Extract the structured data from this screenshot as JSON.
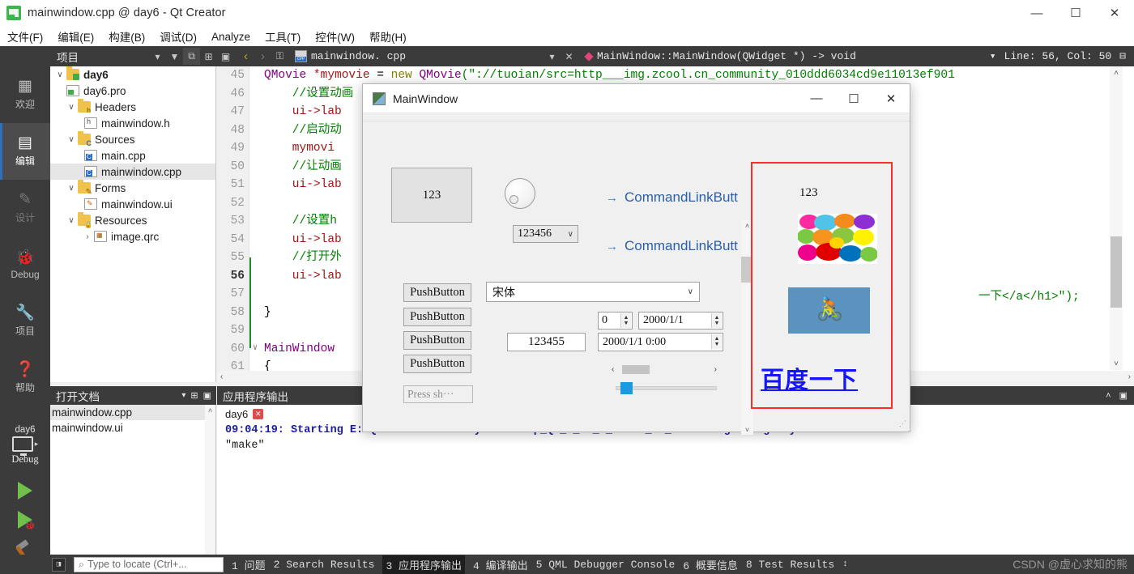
{
  "window": {
    "title": "mainwindow.cpp @ day6 - Qt Creator",
    "minimize": "—",
    "maximize": "☐",
    "close": "✕",
    "app_icon": "qt-creator-icon"
  },
  "menubar": {
    "items": [
      {
        "label": "文件(F)"
      },
      {
        "label": "编辑(E)"
      },
      {
        "label": "构建(B)"
      },
      {
        "label": "调试(D)"
      },
      {
        "label": "Analyze"
      },
      {
        "label": "工具(T)"
      },
      {
        "label": "控件(W)"
      },
      {
        "label": "帮助(H)"
      }
    ]
  },
  "toolrow": {
    "projects_label": "项目",
    "dropdown_caret": "▾",
    "filter_icon": "▼",
    "link_icon": "⧉",
    "split_icon": "⊞",
    "collapse_icon": "▣",
    "back_icon": "‹",
    "forward_icon": "›",
    "lock_icon": "⚿",
    "file_name": "mainwindow. cpp",
    "file_caret": "▾",
    "file_close": "✕",
    "symbol": "MainWindow::MainWindow(QWidget *) -> void",
    "symbol_caret": "▾",
    "line_col": "Line: 56, Col: 50",
    "split_right_icon": "⊟"
  },
  "activitybar": {
    "items": [
      {
        "glyph": "☰",
        "label": "欢迎",
        "state": "normal",
        "name": "welcome"
      },
      {
        "glyph": "▤",
        "label": "编辑",
        "state": "active",
        "name": "edit"
      },
      {
        "glyph": "✎",
        "label": "设计",
        "state": "dim",
        "name": "design"
      },
      {
        "glyph": "☸",
        "label": "Debug",
        "state": "normal",
        "name": "debug"
      },
      {
        "glyph": "⚒",
        "label": "项目",
        "state": "normal",
        "name": "projects"
      },
      {
        "glyph": "?",
        "label": "帮助",
        "state": "normal",
        "name": "help"
      }
    ],
    "kit_name": "day6",
    "kit_mode": "Debug",
    "kit_arrow": "▸"
  },
  "tree": {
    "rows": [
      {
        "twisty": "∨",
        "icon": "folder green",
        "label": "day6",
        "indent": 0,
        "bold": true,
        "selected": false
      },
      {
        "twisty": "",
        "icon": "doc pro",
        "label": "day6.pro",
        "indent": 1,
        "bold": false,
        "selected": false
      },
      {
        "twisty": "∨",
        "icon": "folder h",
        "label": "Headers",
        "indent": 1,
        "bold": false,
        "selected": false
      },
      {
        "twisty": "",
        "icon": "doc hh",
        "label": "mainwindow.h",
        "indent": 2,
        "bold": false,
        "selected": false
      },
      {
        "twisty": "∨",
        "icon": "folder cc",
        "label": "Sources",
        "indent": 1,
        "bold": false,
        "selected": false
      },
      {
        "twisty": "",
        "icon": "doc cpp",
        "label": "main.cpp",
        "indent": 2,
        "bold": false,
        "selected": false
      },
      {
        "twisty": "",
        "icon": "doc cpp",
        "label": "mainwindow.cpp",
        "indent": 2,
        "bold": false,
        "selected": true
      },
      {
        "twisty": "∨",
        "icon": "folder pencil",
        "label": "Forms",
        "indent": 1,
        "bold": false,
        "selected": false
      },
      {
        "twisty": "",
        "icon": "doc ui",
        "label": "mainwindow.ui",
        "indent": 2,
        "bold": false,
        "selected": false
      },
      {
        "twisty": "∨",
        "icon": "folder lock",
        "label": "Resources",
        "indent": 1,
        "bold": false,
        "selected": false
      },
      {
        "twisty": "›",
        "icon": "doc qrc",
        "label": "image.qrc",
        "indent": 2,
        "bold": false,
        "selected": false
      }
    ]
  },
  "editor": {
    "lines": [
      {
        "no": "45",
        "fold": "",
        "current": false,
        "segments": [
          {
            "t": "QMovie ",
            "c": "k-type"
          },
          {
            "t": "*mymovie",
            "c": "k-var"
          },
          {
            "t": " = ",
            "c": "k-plain"
          },
          {
            "t": "new ",
            "c": "k-kw"
          },
          {
            "t": "QMovie",
            "c": "k-fn"
          },
          {
            "t": "(\"://tuoian/src=http___img.zcool.cn_community_010ddd6034cd9e11013ef901",
            "c": "k-str"
          }
        ]
      },
      {
        "no": "46",
        "fold": "",
        "current": false,
        "segments": [
          {
            "t": "  //设置动画",
            "c": "k-com"
          }
        ]
      },
      {
        "no": "47",
        "fold": "",
        "current": false,
        "segments": [
          {
            "t": "  ui->lab",
            "c": "k-var"
          }
        ]
      },
      {
        "no": "48",
        "fold": "",
        "current": false,
        "segments": [
          {
            "t": "  //启动动",
            "c": "k-com"
          }
        ]
      },
      {
        "no": "49",
        "fold": "",
        "current": false,
        "segments": [
          {
            "t": "  mymovi",
            "c": "k-var"
          }
        ]
      },
      {
        "no": "50",
        "fold": "",
        "current": false,
        "segments": [
          {
            "t": "  //让动画",
            "c": "k-com"
          }
        ]
      },
      {
        "no": "51",
        "fold": "",
        "current": false,
        "segments": [
          {
            "t": "  ui->lab",
            "c": "k-var"
          }
        ]
      },
      {
        "no": "52",
        "fold": "",
        "current": false,
        "segments": [
          {
            "t": "",
            "c": "k-plain"
          }
        ]
      },
      {
        "no": "53",
        "fold": "",
        "current": false,
        "segments": [
          {
            "t": "  //设置h",
            "c": "k-com"
          }
        ]
      },
      {
        "no": "54",
        "fold": "",
        "current": false,
        "segments": [
          {
            "t": "  ui->lab",
            "c": "k-var"
          }
        ]
      },
      {
        "no": "55",
        "fold": "",
        "current": false,
        "segments": [
          {
            "t": "  //打开外",
            "c": "k-com"
          }
        ]
      },
      {
        "no": "56",
        "fold": "",
        "current": true,
        "segments": [
          {
            "t": "  ui->lab",
            "c": "k-var"
          }
        ]
      },
      {
        "no": "57",
        "fold": "",
        "current": false,
        "segments": [
          {
            "t": "",
            "c": "k-plain"
          }
        ]
      },
      {
        "no": "58",
        "fold": "",
        "current": false,
        "segments": [
          {
            "t": "}",
            "c": "k-plain"
          }
        ]
      },
      {
        "no": "59",
        "fold": "",
        "current": false,
        "segments": [
          {
            "t": "",
            "c": "k-plain"
          }
        ]
      },
      {
        "no": "60",
        "fold": "∨",
        "current": false,
        "segments": [
          {
            "t": "MainWindow",
            "c": "k-fn"
          }
        ]
      },
      {
        "no": "61",
        "fold": "",
        "current": false,
        "segments": [
          {
            "t": "{",
            "c": "k-plain"
          }
        ]
      }
    ],
    "tail_fragment": "一下</a</h1>\");",
    "scroll_up": "˄",
    "scroll_down": "˅",
    "hscroll_left": "‹",
    "hscroll_right": "›"
  },
  "opendocs": {
    "header": "打开文档",
    "header_caret": "▾",
    "split_icon": "⊞",
    "close_icon": "▣",
    "items": [
      {
        "label": "mainwindow.cpp",
        "selected": true
      },
      {
        "label": "mainwindow.ui",
        "selected": false
      }
    ],
    "scroll_up": "˄"
  },
  "appoutput": {
    "header": "应用程序输出",
    "tab_label": "day6",
    "tab_close": "✕",
    "collapse_icon": "˄",
    "maximize_icon": "▣",
    "lines": [
      {
        "text": "09:04:19: Starting E:\\QT code\\build-day6-Desktop_Qt_5_12_3_MinGW_32_bit-Debug\\debug\\day6.exe ...",
        "style": "bold"
      },
      {
        "text": "\"make\"",
        "style": "plain"
      }
    ]
  },
  "statusbar": {
    "toggle_icon": "◨",
    "search_icon": "⌕",
    "locate_placeholder": "Type to locate (Ctrl+...",
    "tabs": [
      {
        "label": "1 问题",
        "active": false
      },
      {
        "label": "2 Search Results",
        "active": false
      },
      {
        "label": "3 应用程序输出",
        "active": true
      },
      {
        "label": "4 编译输出",
        "active": false
      },
      {
        "label": "5 QML Debugger Console",
        "active": false
      },
      {
        "label": "6 概要信息",
        "active": false
      },
      {
        "label": "8 Test Results",
        "active": false
      }
    ],
    "more_icon": "↕",
    "watermark": "CSDN @虚心求知的熊"
  },
  "qtwindow": {
    "title": "MainWindow",
    "minimize": "—",
    "maximize": "☐",
    "close": "✕",
    "frame_label": "123",
    "combo_small_value": "123456",
    "combo_caret": "∨",
    "command_link_1": "CommandLinkButt",
    "command_link_2": "CommandLinkButt",
    "link_arrow": "→",
    "push_buttons": [
      "PushButton",
      "PushButton",
      "PushButton",
      "PushButton"
    ],
    "key_sequence": "Press sh···",
    "font_combo_value": "宋体",
    "spin_value": "0",
    "date_value": "2000/1/1",
    "lcd_value": "123455",
    "datetime_value": "2000/1/1  0:00",
    "spin_up": "▲",
    "spin_down": "▼",
    "hscroll_left": "‹",
    "hscroll_right": "›",
    "vscroll_up": "˄",
    "vscroll_down": "˅",
    "resize_grip": "⋰"
  },
  "redpanel": {
    "label_123": "123",
    "image_alt": "colorful-pebbles-image",
    "gif_alt": "cyclist-animation",
    "link_text": "百度一下",
    "border_color": "#ff2d2d"
  },
  "colors": {
    "chrome_dark": "#3b3b3b",
    "accent_blue": "#2f6fbf",
    "qt_green": "#3cb54a",
    "red_border": "#ff2d2d",
    "slider_blue": "#1a9ae0"
  }
}
